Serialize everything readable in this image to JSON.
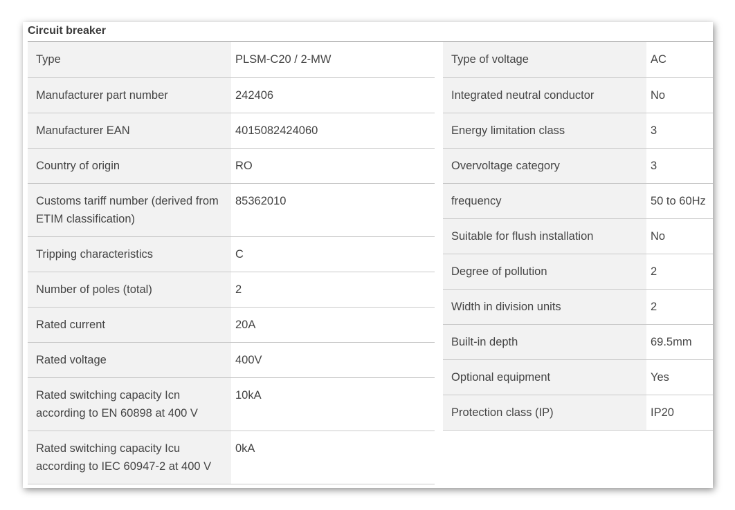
{
  "panel": {
    "title": "Circuit breaker"
  },
  "left_table": [
    {
      "label": "Type",
      "value": "PLSM-C20 / 2-MW"
    },
    {
      "label": "Manufacturer part number",
      "value": "242406"
    },
    {
      "label": "Manufacturer EAN",
      "value": "4015082424060"
    },
    {
      "label": "Country of origin",
      "value": "RO"
    },
    {
      "label": "Customs tariff number (derived from ETIM classification)",
      "value": "85362010"
    },
    {
      "label": "Tripping characteristics",
      "value": "C"
    },
    {
      "label": "Number of poles (total)",
      "value": "2"
    },
    {
      "label": "Rated current",
      "value": "20A"
    },
    {
      "label": "Rated voltage",
      "value": "400V"
    },
    {
      "label": "Rated switching capacity Icn according to EN 60898 at 400 V",
      "value": "10kA"
    },
    {
      "label": "Rated switching capacity Icu according to IEC 60947-2 at 400 V",
      "value": "0kA"
    }
  ],
  "right_table": [
    {
      "label": "Type of voltage",
      "value": "AC"
    },
    {
      "label": "Integrated neutral conductor",
      "value": "No"
    },
    {
      "label": "Energy limitation class",
      "value": "3"
    },
    {
      "label": "Overvoltage category",
      "value": "3"
    },
    {
      "label": "frequency",
      "value": "50 to 60Hz"
    },
    {
      "label": "Suitable for flush installation",
      "value": "No"
    },
    {
      "label": "Degree of pollution",
      "value": "2"
    },
    {
      "label": "Width in division units",
      "value": "2"
    },
    {
      "label": "Built-in depth",
      "value": "69.5mm"
    },
    {
      "label": "Optional equipment",
      "value": "Yes"
    },
    {
      "label": "Protection class (IP)",
      "value": "IP20"
    }
  ]
}
